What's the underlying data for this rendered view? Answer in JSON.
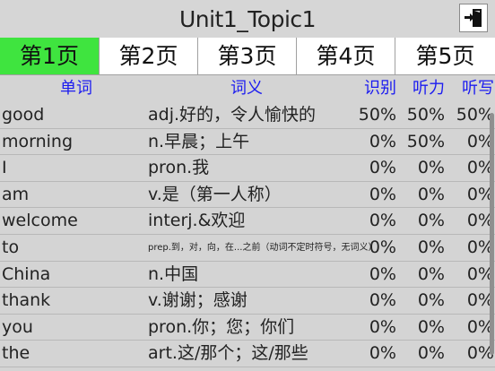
{
  "title": "Unit1_Topic1",
  "exit_icon": "exit-door-icon",
  "tabs": [
    {
      "label": "第1页",
      "active": true
    },
    {
      "label": "第2页",
      "active": false
    },
    {
      "label": "第3页",
      "active": false
    },
    {
      "label": "第4页",
      "active": false
    },
    {
      "label": "第5页",
      "active": false
    }
  ],
  "columns": {
    "word": "单词",
    "definition": "词义",
    "recognize": "识别",
    "listening": "听力",
    "writing": "听写"
  },
  "rows": [
    {
      "word": "good",
      "definition": "adj.好的，令人愉快的",
      "recognize": "50%",
      "listening": "50%",
      "writing": "50%"
    },
    {
      "word": "morning",
      "definition": "n.早晨；上午",
      "recognize": "0%",
      "listening": "50%",
      "writing": "0%"
    },
    {
      "word": "I",
      "definition": "pron.我",
      "recognize": "0%",
      "listening": "0%",
      "writing": "0%"
    },
    {
      "word": "am",
      "definition": "v.是（第一人称）",
      "recognize": "0%",
      "listening": "0%",
      "writing": "0%"
    },
    {
      "word": "welcome",
      "definition": "interj.&欢迎",
      "recognize": "0%",
      "listening": "0%",
      "writing": "0%"
    },
    {
      "word": "to",
      "definition": "prep.到，对，向，在...之前（动词不定时符号，无词义）",
      "recognize": "0%",
      "listening": "0%",
      "writing": "0%"
    },
    {
      "word": "China",
      "definition": "n.中国",
      "recognize": "0%",
      "listening": "0%",
      "writing": "0%"
    },
    {
      "word": "thank",
      "definition": "v.谢谢；感谢",
      "recognize": "0%",
      "listening": "0%",
      "writing": "0%"
    },
    {
      "word": "you",
      "definition": "pron.你；您；你们",
      "recognize": "0%",
      "listening": "0%",
      "writing": "0%"
    },
    {
      "word": "the",
      "definition": "art.这/那个；这/那些",
      "recognize": "0%",
      "listening": "0%",
      "writing": "0%"
    }
  ]
}
